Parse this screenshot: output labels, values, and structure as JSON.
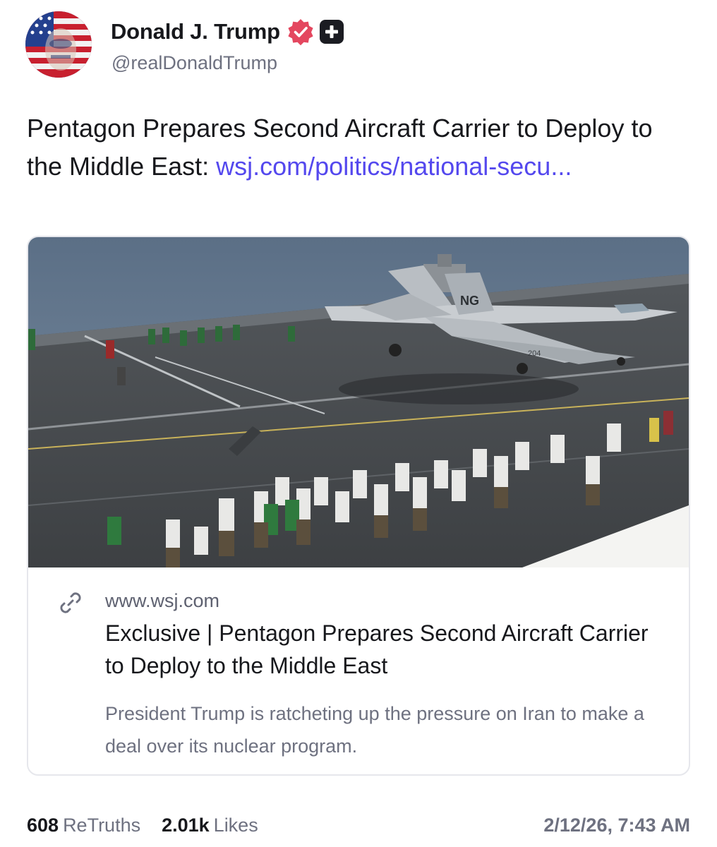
{
  "author": {
    "display_name": "Donald J. Trump",
    "handle": "@realDonaldTrump",
    "avatar_icon": "flag-portrait-avatar",
    "verified_icon": "verified-badge-icon",
    "verified_color": "#e4475f",
    "plus_icon": "plus-badge-icon"
  },
  "post": {
    "text": "Pentagon Prepares Second Aircraft Carrier to Deploy to the Middle East: ",
    "link_text": "wsj.com/politics/national-secu...",
    "link_color": "#5448ee"
  },
  "card": {
    "image_icon": "aircraft-carrier-photo",
    "aircraft_tail": "NG",
    "aircraft_number": "204",
    "link_icon": "chain-link-icon",
    "domain": "www.wsj.com",
    "title": "Exclusive | Pentagon Prepares Second Aircraft Carrier to Deploy to the Middle East",
    "description": "President Trump is ratcheting up the pressure on Iran to make a deal over its nuclear program."
  },
  "stats": {
    "retruths_count": "608",
    "retruths_label": "ReTruths",
    "likes_count": "2.01k",
    "likes_label": "Likes",
    "timestamp": "2/12/26, 7:43 AM"
  }
}
